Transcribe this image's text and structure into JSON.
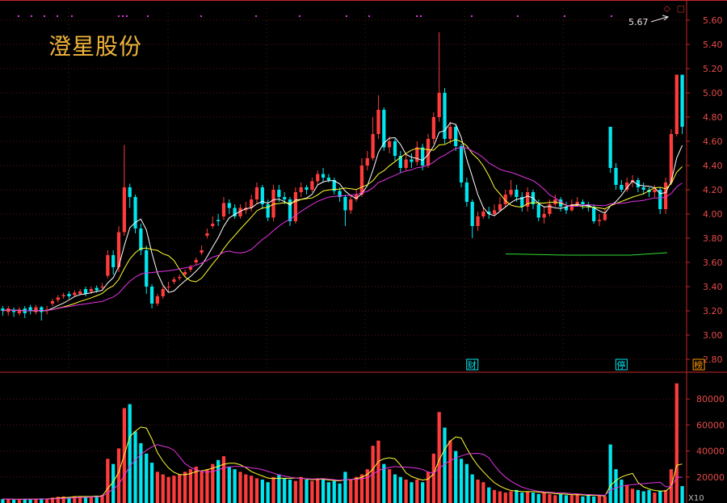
{
  "stock_name": "澄星股份",
  "colors": {
    "up": "#ff3c3c",
    "down": "#00e5ee",
    "ma5": "#ffffff",
    "ma10": "#ffff33",
    "ma20": "#e433e4",
    "ma_extra": "#33dd33",
    "axis": "#c82828",
    "grid": "#5a1414"
  },
  "icons": [
    "diamond-icon",
    "window-icon"
  ],
  "chart_data": [
    {
      "type": "candlestick",
      "title": "",
      "ylim": [
        2.7,
        5.7
      ],
      "y_ticks": [
        "2.80",
        "3.00",
        "3.20",
        "3.40",
        "3.60",
        "3.80",
        "4.00",
        "4.20",
        "4.40",
        "4.60",
        "4.80",
        "5.00",
        "5.20",
        "5.40",
        "5.60"
      ],
      "grid": true,
      "peak_annotation": "5.67",
      "markers": [
        {
          "label": "财",
          "day": 85,
          "color": "#00e5ee"
        },
        {
          "label": "停",
          "day": 112,
          "color": "#00e5ee"
        },
        {
          "label": "榜",
          "day": 126,
          "color": "#ff9900"
        }
      ],
      "ohlc_close": [
        3.2,
        3.22,
        3.19,
        3.21,
        3.18,
        3.2,
        3.23,
        3.19,
        3.21,
        3.28,
        3.31,
        3.33,
        3.32,
        3.35,
        3.36,
        3.34,
        3.38,
        3.37,
        3.4,
        3.66,
        3.56,
        3.85,
        4.22,
        4.14,
        3.88,
        3.7,
        3.4,
        3.26,
        3.32,
        3.38,
        3.4,
        3.46,
        3.48,
        3.52,
        3.56,
        3.62,
        3.7,
        3.84,
        3.92,
        3.94,
        4.09,
        4.05,
        3.98,
        4.05,
        4.05,
        4.12,
        4.22,
        4.08,
        3.97,
        4.2,
        4.14,
        4.12,
        3.94,
        4.18,
        4.22,
        4.2,
        4.27,
        4.33,
        4.3,
        4.28,
        4.19,
        4.14,
        4.03,
        4.12,
        4.16,
        4.4,
        4.46,
        4.66,
        4.86,
        4.55,
        4.6,
        4.48,
        4.38,
        4.45,
        4.43,
        4.55,
        4.4,
        4.62,
        4.8,
        5.0,
        4.62,
        4.72,
        4.56,
        4.26,
        4.1,
        3.9,
        3.98,
        4.02,
        4.0,
        4.03,
        4.08,
        4.16,
        4.2,
        4.14,
        4.06,
        4.18,
        4.08,
        3.97,
        4.0,
        4.08,
        4.12,
        4.06,
        4.03,
        4.08,
        4.1,
        4.08,
        4.06,
        3.94,
        3.95,
        4.0,
        4.38,
        4.24,
        4.2,
        4.26,
        4.28,
        4.22,
        4.2,
        4.18,
        4.2,
        4.04,
        4.26,
        4.66,
        5.15,
        4.72
      ],
      "ohlc_open": [
        3.22,
        3.19,
        3.21,
        3.18,
        3.22,
        3.23,
        3.19,
        3.23,
        3.2,
        3.26,
        3.29,
        3.32,
        3.34,
        3.33,
        3.34,
        3.38,
        3.36,
        3.39,
        3.4,
        3.49,
        3.66,
        3.56,
        3.85,
        4.22,
        4.14,
        3.88,
        3.7,
        3.4,
        3.26,
        3.32,
        3.4,
        3.44,
        3.47,
        3.5,
        3.54,
        3.6,
        3.68,
        3.82,
        3.9,
        3.95,
        3.98,
        4.09,
        4.05,
        3.98,
        4.03,
        4.05,
        4.12,
        4.22,
        4.08,
        3.97,
        4.2,
        4.14,
        4.12,
        3.94,
        4.18,
        4.22,
        4.2,
        4.27,
        4.33,
        4.3,
        4.28,
        4.19,
        4.14,
        4.03,
        4.12,
        4.16,
        4.4,
        4.46,
        4.66,
        4.86,
        4.55,
        4.6,
        4.48,
        4.38,
        4.45,
        4.43,
        4.55,
        4.4,
        4.62,
        4.8,
        5.0,
        4.62,
        4.72,
        4.56,
        4.26,
        4.1,
        3.9,
        3.98,
        4.02,
        4.0,
        4.03,
        4.08,
        4.16,
        4.2,
        4.14,
        4.06,
        4.18,
        4.08,
        3.97,
        4.0,
        4.08,
        4.12,
        4.06,
        4.03,
        4.08,
        4.1,
        4.08,
        4.06,
        3.94,
        3.95,
        4.72,
        4.38,
        4.24,
        4.2,
        4.26,
        4.28,
        4.22,
        4.2,
        4.18,
        4.2,
        4.04,
        4.26,
        4.66,
        5.15
      ],
      "ohlc_high": [
        3.24,
        3.24,
        3.23,
        3.23,
        3.24,
        3.25,
        3.25,
        3.24,
        3.24,
        3.3,
        3.33,
        3.35,
        3.36,
        3.37,
        3.38,
        3.4,
        3.4,
        3.41,
        3.43,
        3.7,
        3.7,
        3.9,
        4.57,
        4.25,
        4.16,
        3.92,
        3.74,
        3.42,
        3.34,
        3.4,
        3.44,
        3.48,
        3.5,
        3.54,
        3.58,
        3.64,
        3.74,
        3.88,
        3.98,
        4.0,
        4.14,
        4.12,
        4.08,
        4.08,
        4.1,
        4.16,
        4.26,
        4.24,
        4.12,
        4.24,
        4.24,
        4.18,
        4.14,
        4.22,
        4.26,
        4.24,
        4.3,
        4.36,
        4.38,
        4.33,
        4.3,
        4.22,
        4.16,
        4.16,
        4.2,
        4.46,
        4.52,
        4.8,
        4.98,
        4.88,
        4.64,
        4.62,
        4.52,
        4.5,
        4.5,
        4.6,
        4.58,
        4.66,
        4.84,
        5.5,
        5.04,
        4.76,
        4.74,
        4.58,
        4.3,
        4.12,
        4.02,
        4.06,
        4.06,
        4.08,
        4.14,
        4.2,
        4.28,
        4.24,
        4.18,
        4.22,
        4.2,
        4.12,
        4.06,
        4.12,
        4.16,
        4.14,
        4.1,
        4.12,
        4.14,
        4.12,
        4.1,
        4.08,
        4.0,
        4.04,
        4.72,
        4.42,
        4.28,
        4.3,
        4.32,
        4.3,
        4.26,
        4.22,
        4.24,
        4.22,
        4.3,
        4.7,
        5.15,
        5.15
      ],
      "ohlc_low": [
        3.16,
        3.16,
        3.15,
        3.16,
        3.14,
        3.17,
        3.17,
        3.12,
        3.17,
        3.24,
        3.27,
        3.3,
        3.3,
        3.32,
        3.33,
        3.32,
        3.34,
        3.35,
        3.38,
        3.47,
        3.5,
        3.52,
        3.82,
        4.05,
        3.84,
        3.66,
        3.34,
        3.22,
        3.24,
        3.3,
        3.36,
        3.42,
        3.45,
        3.48,
        3.52,
        3.58,
        3.66,
        3.8,
        3.88,
        3.9,
        3.95,
        4.0,
        3.96,
        3.96,
        4.0,
        4.02,
        4.08,
        4.04,
        3.94,
        3.94,
        4.1,
        4.08,
        3.9,
        3.92,
        4.14,
        4.16,
        4.18,
        4.24,
        4.26,
        4.26,
        4.16,
        4.1,
        3.9,
        4.0,
        4.1,
        4.14,
        4.36,
        4.44,
        4.62,
        4.52,
        4.5,
        4.44,
        4.34,
        4.36,
        4.38,
        4.4,
        4.36,
        4.38,
        4.58,
        4.76,
        4.58,
        4.58,
        4.52,
        4.22,
        4.06,
        3.8,
        3.86,
        3.96,
        3.96,
        3.98,
        4.02,
        4.06,
        4.14,
        4.1,
        4.02,
        4.02,
        4.04,
        3.94,
        3.92,
        3.98,
        4.06,
        4.02,
        4.0,
        4.02,
        4.06,
        4.04,
        4.02,
        3.92,
        3.9,
        3.94,
        4.34,
        4.2,
        4.18,
        4.18,
        4.22,
        4.18,
        4.16,
        4.14,
        4.14,
        4.0,
        4.0,
        4.24,
        4.64,
        4.66
      ]
    },
    {
      "type": "bar",
      "title": "",
      "ylim": [
        0,
        95000
      ],
      "y_ticks": [
        "20000",
        "40000",
        "60000",
        "80000"
      ],
      "series_name": "volume",
      "corner_label": "X10",
      "values": [
        3000,
        3200,
        2600,
        2800,
        3100,
        2900,
        3300,
        3500,
        3000,
        4200,
        4800,
        5100,
        4600,
        5200,
        5000,
        4800,
        5300,
        5600,
        6200,
        34000,
        30000,
        42000,
        73000,
        76000,
        55000,
        46000,
        38000,
        31000,
        24000,
        22000,
        20000,
        21000,
        22000,
        24000,
        26000,
        28000,
        24000,
        26000,
        30000,
        33000,
        36000,
        28000,
        26000,
        24000,
        22000,
        21000,
        19000,
        18000,
        16000,
        20000,
        22000,
        19000,
        18000,
        17000,
        20000,
        18000,
        17000,
        19000,
        18000,
        16000,
        17000,
        15000,
        24000,
        18000,
        20000,
        22000,
        26000,
        44000,
        48000,
        30000,
        26000,
        22000,
        20000,
        18000,
        16000,
        18000,
        16000,
        24000,
        38000,
        70000,
        58000,
        48000,
        40000,
        34000,
        30000,
        22000,
        18000,
        16000,
        12000,
        10000,
        9000,
        8000,
        9000,
        10000,
        8000,
        9000,
        8000,
        7000,
        8000,
        7000,
        6000,
        7000,
        6000,
        6000,
        7000,
        5000,
        6000,
        5000,
        6000,
        5000,
        45000,
        26000,
        18000,
        14000,
        11000,
        10000,
        9000,
        10000,
        8000,
        9000,
        10000,
        26000,
        92000,
        13000
      ]
    }
  ]
}
